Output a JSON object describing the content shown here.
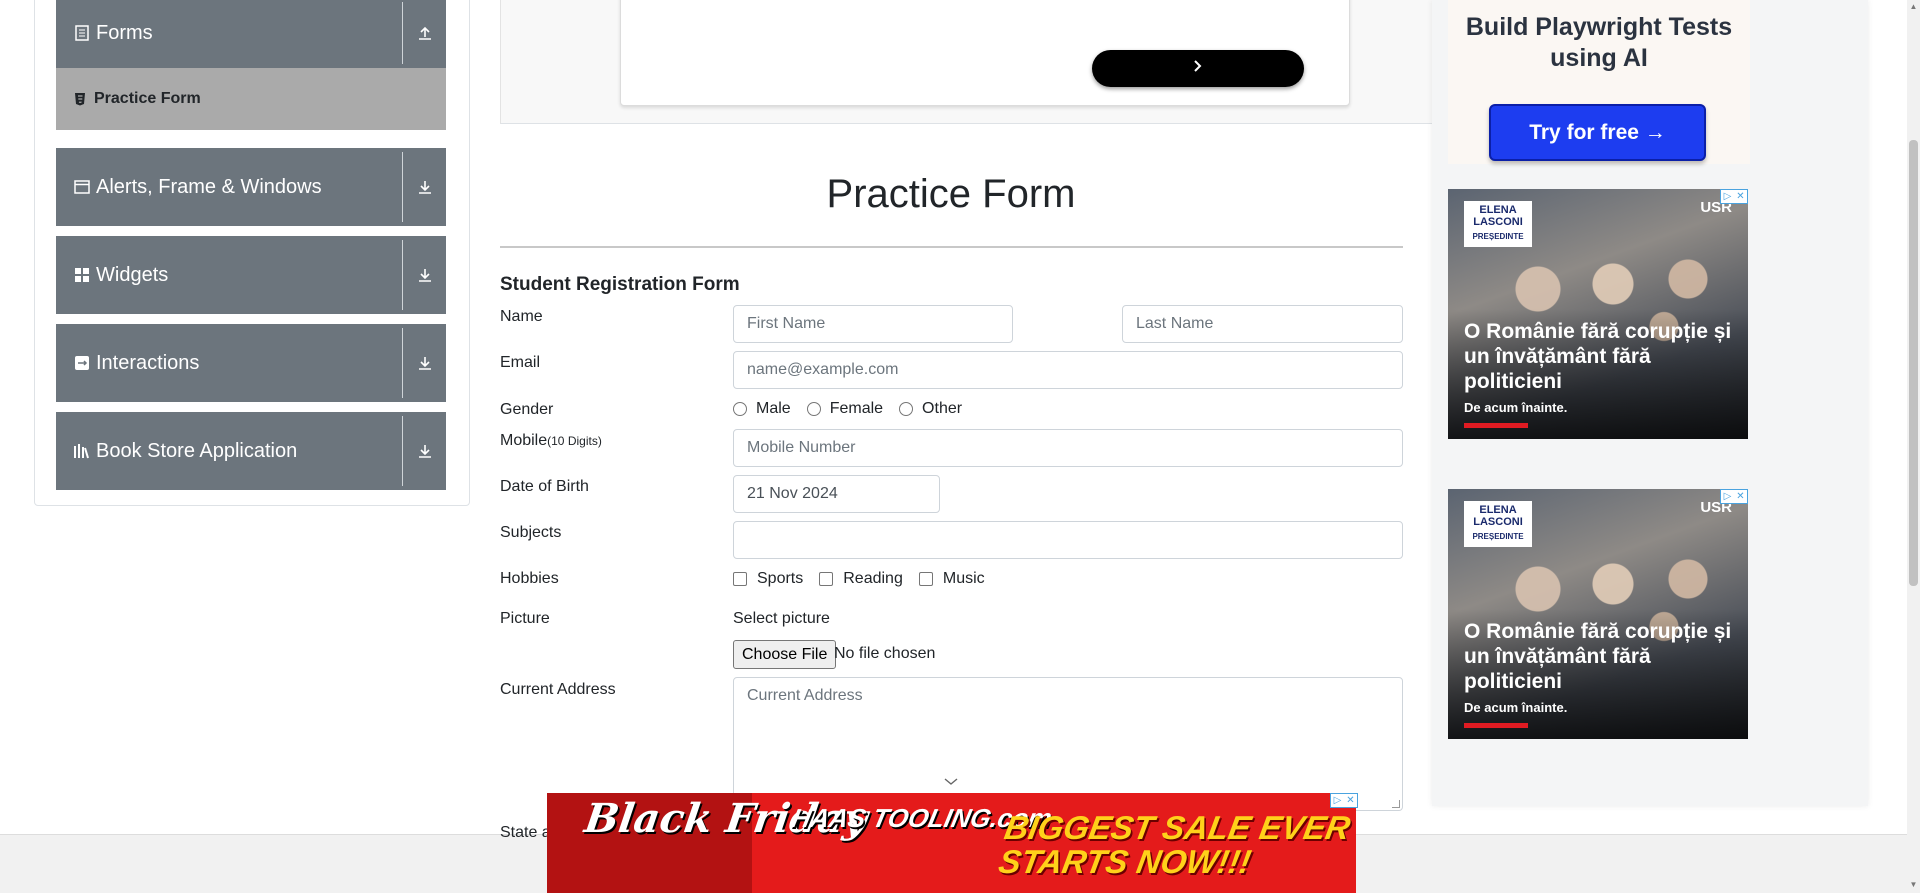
{
  "sidebar": {
    "groups": [
      {
        "label": "Forms",
        "icon": "document-icon",
        "arrow": "collapse-icon"
      },
      {
        "label": "Alerts, Frame & Windows",
        "icon": "window-icon",
        "arrow": "expand-icon"
      },
      {
        "label": "Widgets",
        "icon": "grid-icon",
        "arrow": "expand-icon"
      },
      {
        "label": "Interactions",
        "icon": "interaction-icon",
        "arrow": "expand-icon"
      },
      {
        "label": "Book Store Application",
        "icon": "books-icon",
        "arrow": "expand-icon"
      }
    ],
    "active_item": "Practice Form"
  },
  "page": {
    "title": "Practice Form",
    "subtitle": "Student Registration Form"
  },
  "form": {
    "name_label": "Name",
    "first_name_placeholder": "First Name",
    "last_name_placeholder": "Last Name",
    "email_label": "Email",
    "email_placeholder": "name@example.com",
    "gender_label": "Gender",
    "gender_options": [
      "Male",
      "Female",
      "Other"
    ],
    "mobile_label": "Mobile",
    "mobile_hint": "(10 Digits)",
    "mobile_placeholder": "Mobile Number",
    "dob_label": "Date of Birth",
    "dob_value": "21 Nov 2024",
    "subjects_label": "Subjects",
    "hobbies_label": "Hobbies",
    "hobby_options": [
      "Sports",
      "Reading",
      "Music"
    ],
    "picture_label": "Picture",
    "select_picture_label": "Select picture",
    "choose_file_label": "Choose File",
    "no_file_text": "No file chosen",
    "address_label": "Current Address",
    "address_placeholder": "Current Address",
    "partial_label": "State a"
  },
  "ads": {
    "top": {
      "title": "Build Playwright Tests using AI",
      "button": "Try for free →"
    },
    "campaign": {
      "badge_name": "ELENA LASCONI",
      "badge_role": "PREȘEDINTE",
      "party": "USR",
      "headline": "O Românie fără corupție și un învățământ fără politicieni",
      "subline": "De acum înainte."
    },
    "banner": {
      "left_text": "Black Friday",
      "brand_text": "HAAS TOOLING.com",
      "sale_text": "BIGGEST SALE EVER STARTS NOW!!!"
    }
  },
  "colors": {
    "sidebar_group_bg": "#6c757d",
    "active_item_bg": "#aaaaaa",
    "try_button_bg": "#1d3df0",
    "banner_red": "#e41b1b",
    "sale_yellow": "#ffd11a"
  }
}
